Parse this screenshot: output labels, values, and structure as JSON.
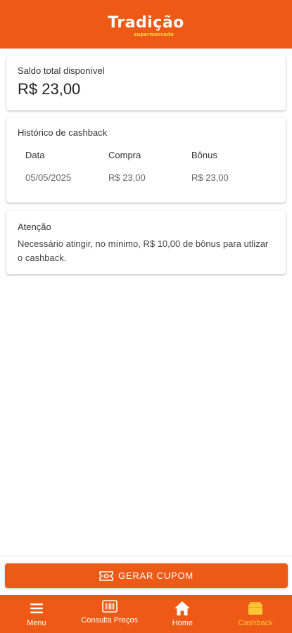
{
  "header": {
    "logo_main": "Tradição",
    "logo_sub": "supermercado"
  },
  "balance": {
    "label": "Saldo total disponível",
    "value": "R$ 23,00"
  },
  "history": {
    "title": "Histórico de cashback",
    "columns": [
      "Data",
      "Compra",
      "Bônus"
    ],
    "rows": [
      [
        "05/05/2025",
        "R$ 23,00",
        "R$ 23,00"
      ]
    ]
  },
  "notice": {
    "title": "Atenção",
    "text": "Necessário atingir, no mínimo, R$ 10,00 de bônus para utlizar o cashback."
  },
  "coupon_button": {
    "label": "GERAR CUPOM",
    "icon": "ticket-icon"
  },
  "nav": {
    "items": [
      {
        "label": "Menu",
        "icon": "menu-icon",
        "active": false
      },
      {
        "label": "Consulta Preços",
        "icon": "barcode-icon",
        "active": false
      },
      {
        "label": "Home",
        "icon": "home-icon",
        "active": false
      },
      {
        "label": "Cashback",
        "icon": "wallet-icon",
        "active": true
      }
    ]
  },
  "colors": {
    "brand_orange": "#ee5a16",
    "active_nav": "#ffc535",
    "logo_sub": "#ffd23f"
  }
}
